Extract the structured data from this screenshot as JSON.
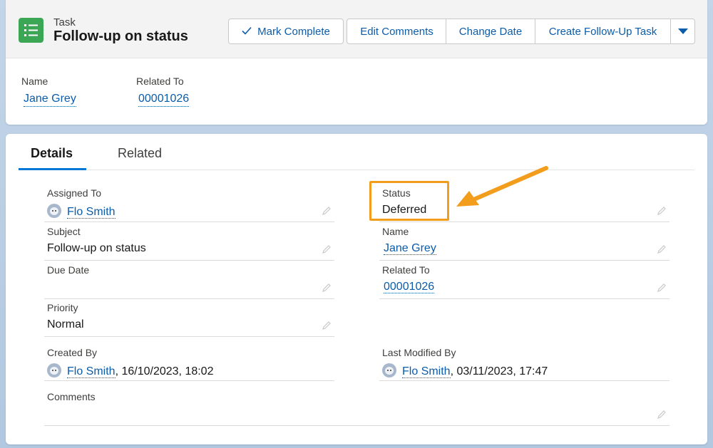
{
  "header": {
    "object_label": "Task",
    "record_title": "Follow-up on status",
    "icon": "task-list-icon",
    "actions": {
      "mark_complete": "Mark Complete",
      "edit_comments": "Edit Comments",
      "change_date": "Change Date",
      "create_followup": "Create Follow-Up Task",
      "more_icon": "chevron-down-icon"
    },
    "highlights": {
      "name_label": "Name",
      "name_value": "Jane Grey",
      "related_label": "Related To",
      "related_value": "00001026"
    }
  },
  "tabs": {
    "details": "Details",
    "related": "Related"
  },
  "fields": {
    "assigned_to": {
      "label": "Assigned To",
      "value": "Flo Smith"
    },
    "status": {
      "label": "Status",
      "value": "Deferred"
    },
    "subject": {
      "label": "Subject",
      "value": "Follow-up on status"
    },
    "name": {
      "label": "Name",
      "value": "Jane Grey"
    },
    "due_date": {
      "label": "Due Date",
      "value": ""
    },
    "related_to": {
      "label": "Related To",
      "value": "00001026"
    },
    "priority": {
      "label": "Priority",
      "value": "Normal"
    },
    "created_by": {
      "label": "Created By",
      "user": "Flo Smith",
      "date": ", 16/10/2023, 18:02"
    },
    "last_modified_by": {
      "label": "Last Modified By",
      "user": "Flo Smith",
      "date": ", 03/11/2023, 17:47"
    },
    "comments": {
      "label": "Comments",
      "value": ""
    }
  },
  "colors": {
    "accent": "#0b5cab",
    "task_icon": "#3ba755",
    "highlight": "#f29d1b"
  }
}
